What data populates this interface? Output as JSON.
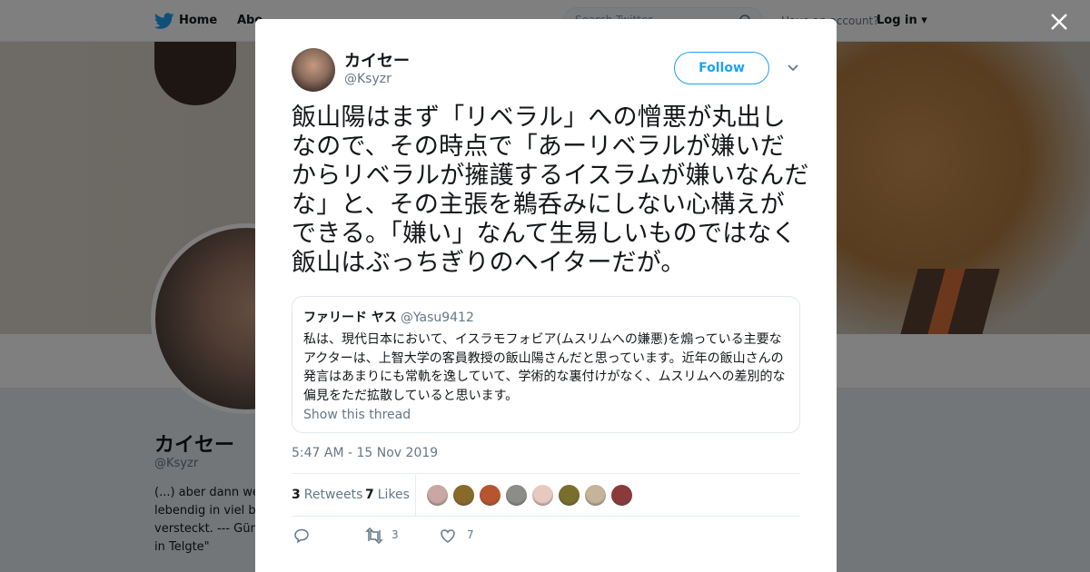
{
  "topbar": {
    "home_label": "Home",
    "about_label": "Abo",
    "search_placeholder": "Search Twitter",
    "account_prompt": "Have an account?",
    "login_label": "Log in"
  },
  "profile": {
    "name": "カイセー",
    "handle": "@Ksyzr",
    "bio": "(...) aber dann we lebendig in viel be versteckt. --- Gün in Telgte\""
  },
  "tweet": {
    "author_name": "カイセー",
    "author_handle": "@Ksyzr",
    "follow_label": "Follow",
    "text": "飯山陽はまず「リベラル」への憎悪が丸出しなので、その時点で「あーリベラルが嫌いだからリベラルが擁護するイスラムが嫌いなんだな」と、その主張を鵜呑みにしない心構えができる。「嫌い」なんて生易しいものではなく飯山はぶっちぎりのヘイターだが。",
    "quote": {
      "name": "ファリード ヤス",
      "handle": "@Yasu9412",
      "text": "私は、現代日本において、イスラモフォビア(ムスリムへの嫌悪)を煽っている主要なアクターは、上智大学の客員教授の飯山陽さんだと思っています。近年の飯山さんの発言はあまりにも常軌を逸していて、学術的な裏付けがなく、ムスリムへの差別的な偏見をただ拡散していると思います。",
      "show_thread": "Show this thread"
    },
    "timestamp": "5:47 AM - 15 Nov 2019",
    "retweets_count": "3",
    "retweets_label": "Retweets",
    "likes_count": "7",
    "likes_label": "Likes",
    "action_retweet_count": "3",
    "action_like_count": "7",
    "liker_colors": [
      "#c9a7a3",
      "#8a6a2a",
      "#b7552f",
      "#8c8c88",
      "#e7c9c0",
      "#7a6e2c",
      "#c5b39a",
      "#8b3a3a"
    ]
  },
  "colors": {
    "accent": "#1da1f2",
    "text": "#14171a",
    "muted": "#657786"
  }
}
